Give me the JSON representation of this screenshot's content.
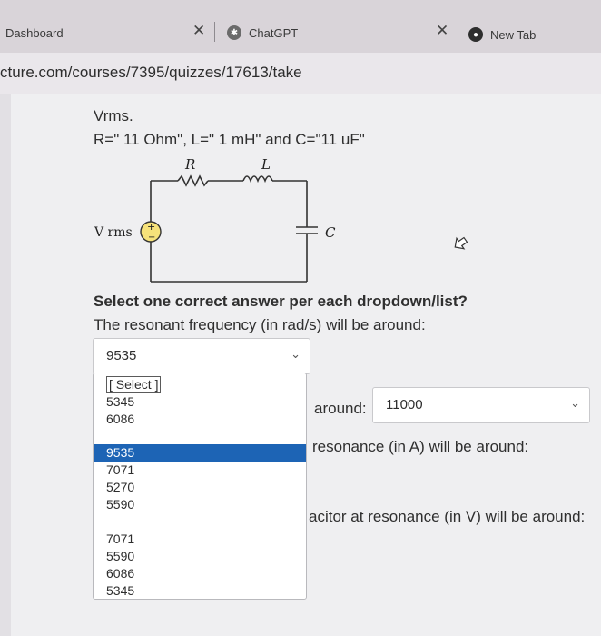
{
  "browser": {
    "tabs": [
      {
        "label": "Dashboard"
      },
      {
        "label": "ChatGPT"
      },
      {
        "label": "New Tab"
      }
    ],
    "url": "cture.com/courses/7395/quizzes/17613/take"
  },
  "question": {
    "heading": "Vrms.",
    "params": "R=\" 11 Ohm\", L=\" 1 mH\" and C=\"11 uF\"",
    "circuit_labels": {
      "r": "R",
      "l": "L",
      "source": "V rms",
      "c": "C"
    },
    "instruction": "Select one correct answer per each dropdown/list?",
    "prompt1": "The resonant frequency (in rad/s) will be around:",
    "prompt2_fragment": "around:",
    "prompt3_fragment": "resonance (in A) will be around:",
    "prompt4_fragment": "acitor at resonance (in V) will be around:"
  },
  "select1": {
    "value": "9535",
    "options": [
      "[ Select ]",
      "5345",
      "6086",
      "9535",
      "7071",
      "5270",
      "5590",
      "7071",
      "5590",
      "6086",
      "5345"
    ],
    "selected_index": 3
  },
  "select2": {
    "value": "11000"
  },
  "colors": {
    "highlight": "#1d64b5"
  }
}
